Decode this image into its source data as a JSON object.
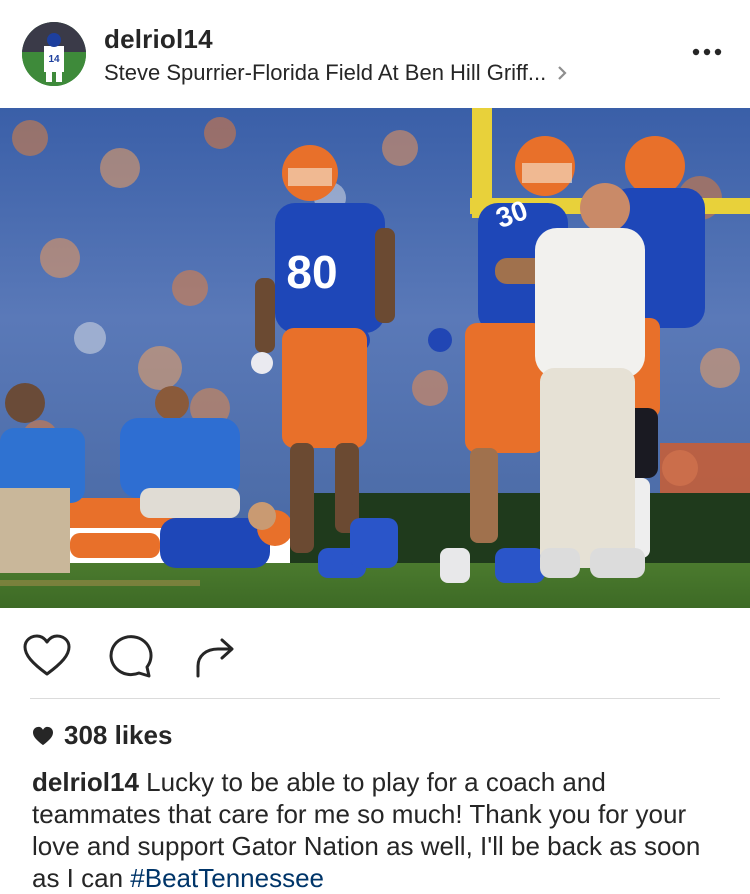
{
  "post": {
    "username": "delriol14",
    "location": "Steve Spurrier-Florida Field At Ben Hill Griff...",
    "likes": "308 likes",
    "caption_text": "Lucky to be able to play for a coach and teammates that care for me so much! Thank you for your love and support Gator Nation as well, I'll be back as soon as I can",
    "hashtag": "#BeatTennessee",
    "avatar_jersey": "14",
    "photo_jerseys": [
      "80",
      "30"
    ]
  },
  "icons": {
    "more": "more-options-icon",
    "location_chevron": "chevron-right-icon",
    "like": "heart-icon",
    "comment": "comment-icon",
    "share": "share-icon",
    "likes_heart": "heart-filled-icon"
  },
  "colors": {
    "text": "#262626",
    "hashtag": "#003569",
    "divider": "#dbdbdb",
    "gator_blue": "#1e47b8",
    "gator_orange": "#e8702a"
  }
}
